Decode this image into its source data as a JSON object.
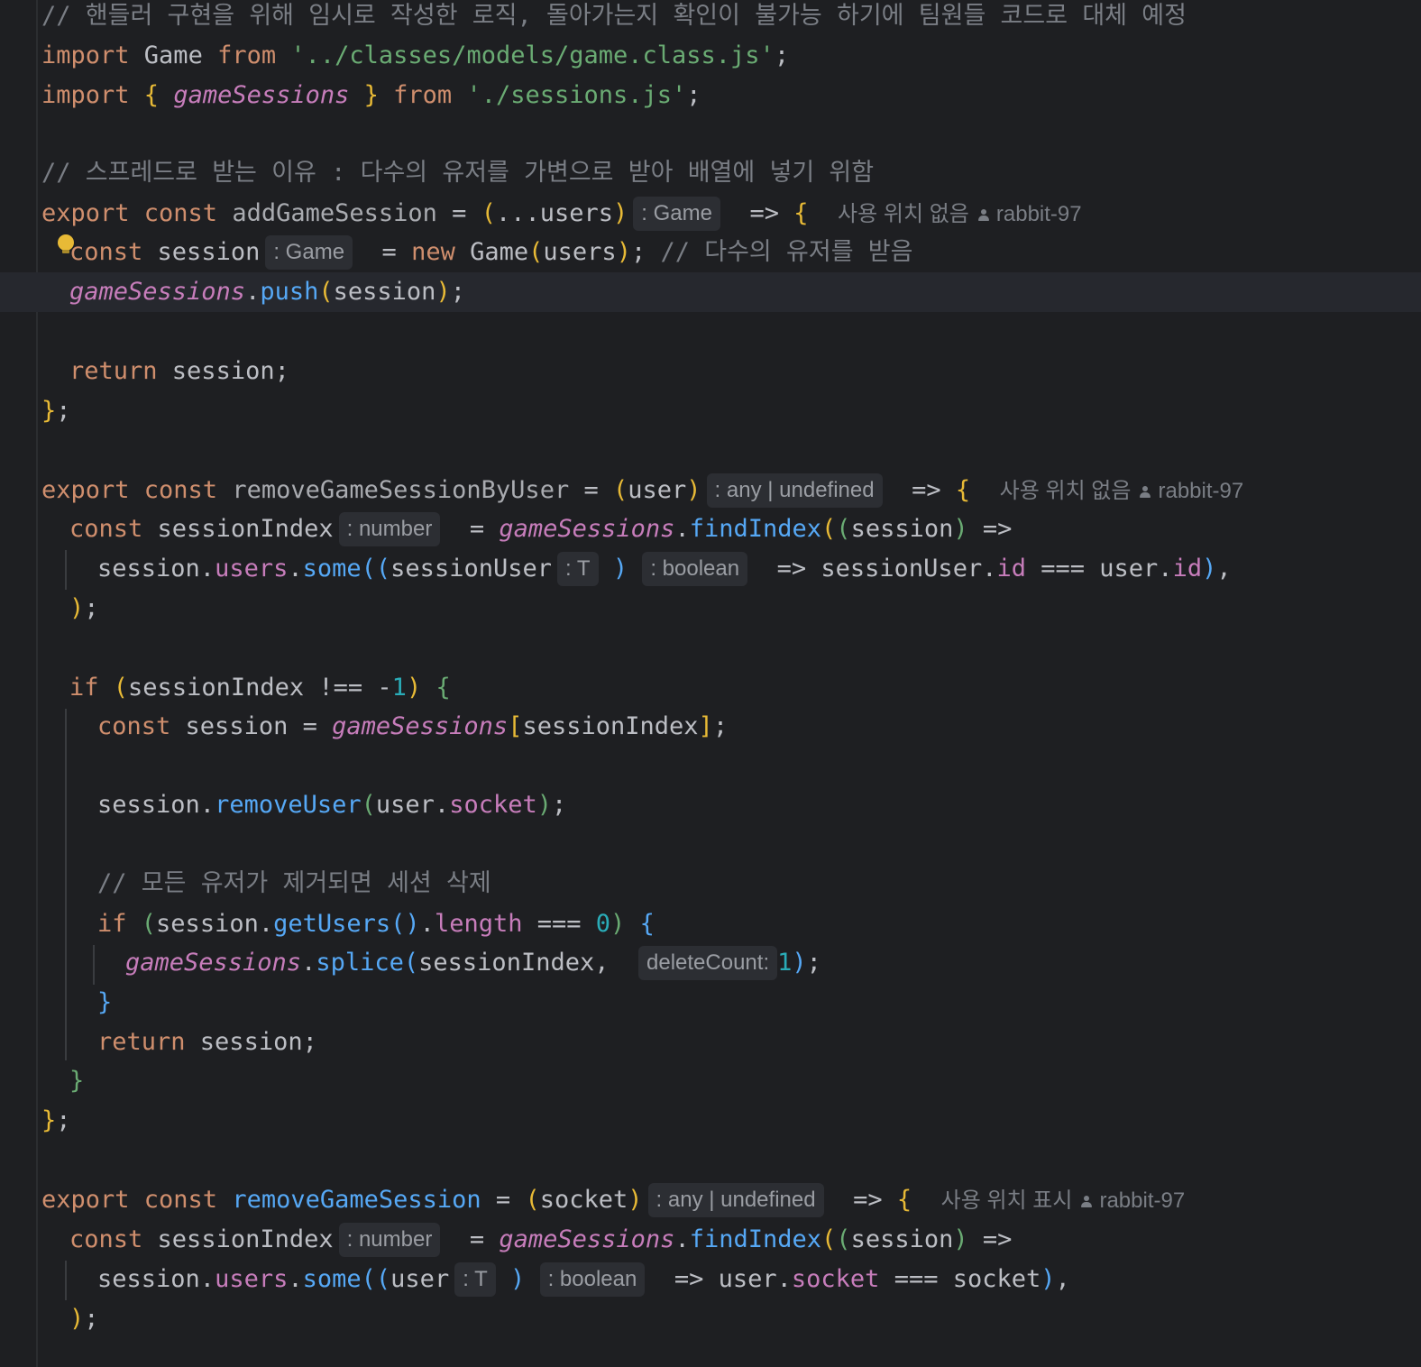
{
  "editor": {
    "language": "javascript",
    "usages": {
      "none": "사용 위치 없음",
      "show": "사용 위치 표시"
    },
    "author": "rabbit-97",
    "comments": {
      "header": "// 핸들러 구현을 위해 임시로 작성한 로직, 돌아가는지 확인이 불가능 하기에 팀원들 코드로 대체 예정",
      "spread": "// 스프레드로 받는 이유 : 다수의 유저를 가변으로 받아 배열에 넣기 위함",
      "multiUsers": "// 다수의 유저를 받음",
      "removeAll": "// 모든 유저가 제거되면 세션 삭제"
    },
    "hints": {
      "game": ": Game",
      "anyUndefined": ": any | undefined",
      "number": ": number",
      "t": ": T",
      "boolean": ": boolean",
      "deleteCount": "deleteCount:"
    },
    "identifiers": {
      "game": "Game",
      "gameSessions": "gameSessions",
      "addGameSession": "addGameSession",
      "removeGameSessionByUser": "removeGameSessionByUser",
      "removeGameSession": "removeGameSession",
      "session": "session",
      "users": "users",
      "user": "user",
      "socket": "socket",
      "sessionIndex": "sessionIndex",
      "sessionUser": "sessionUser",
      "push": "push",
      "findIndex": "findIndex",
      "some": "some",
      "id": "id",
      "removeUser": "removeUser",
      "getUsers": "getUsers",
      "length": "length",
      "splice": "splice"
    },
    "strings": {
      "gamePath": "'../classes/models/game.class.js'",
      "sessionsPath": "'./sessions.js'"
    },
    "numbers": {
      "negOne": "1",
      "zero": "0",
      "one": "1"
    }
  }
}
